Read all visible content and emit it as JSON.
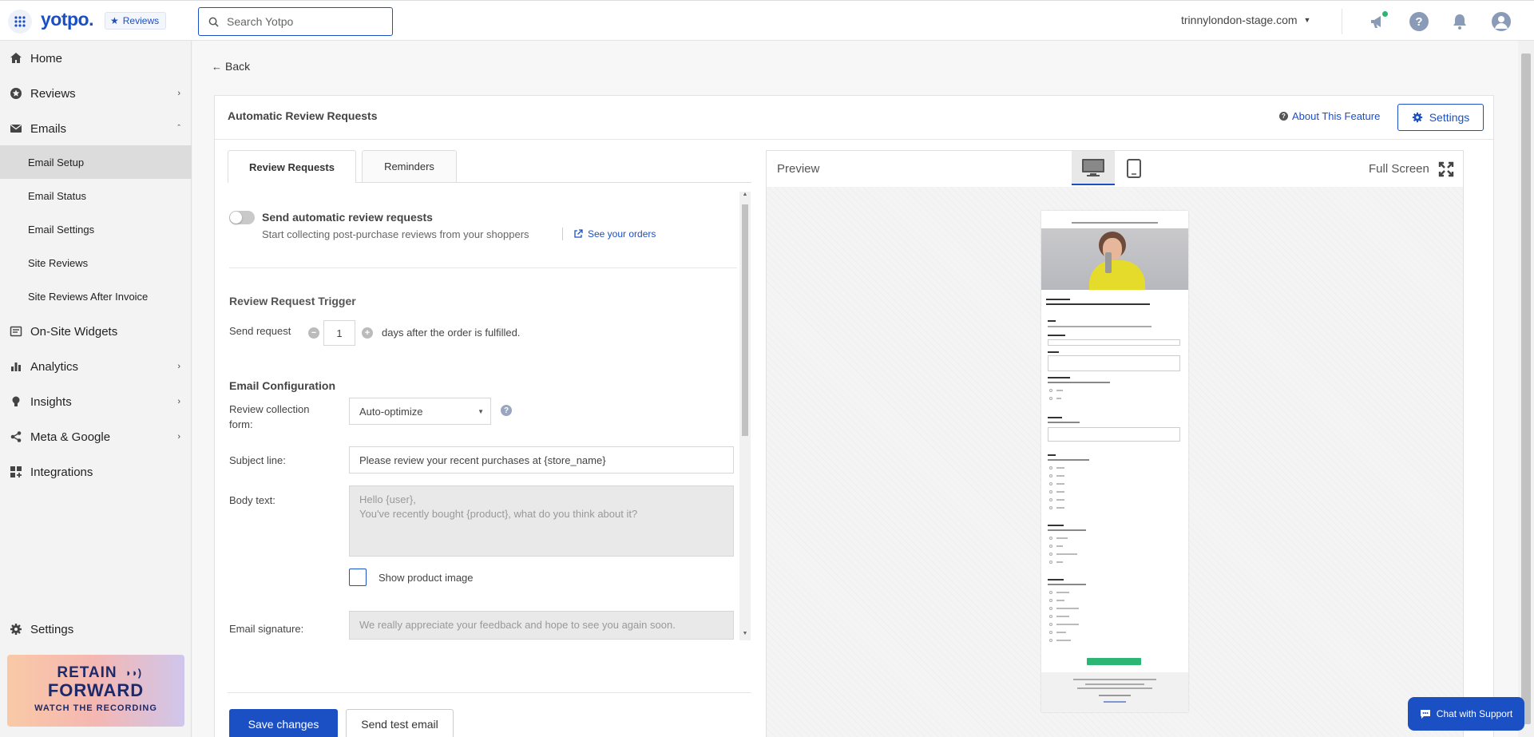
{
  "topbar": {
    "logo": "yotpo.",
    "product_badge": "Reviews",
    "search_placeholder": "Search Yotpo",
    "store": "trinnylondon-stage.com"
  },
  "sidebar": {
    "items": [
      {
        "label": "Home"
      },
      {
        "label": "Reviews"
      },
      {
        "label": "Emails"
      },
      {
        "label": "On-Site Widgets"
      },
      {
        "label": "Analytics"
      },
      {
        "label": "Insights"
      },
      {
        "label": "Meta & Google"
      },
      {
        "label": "Integrations"
      }
    ],
    "email_sub": [
      {
        "label": "Email Setup"
      },
      {
        "label": "Email Status"
      },
      {
        "label": "Email Settings"
      },
      {
        "label": "Site Reviews"
      },
      {
        "label": "Site Reviews After Invoice"
      }
    ],
    "settings": "Settings",
    "promo": {
      "line1": "RETAIN",
      "line2": "FORWARD",
      "line3": "WATCH THE RECORDING"
    }
  },
  "main": {
    "back": "Back",
    "card_title": "Automatic Review Requests",
    "about_link": "About This Feature",
    "settings_button": "Settings",
    "tabs": [
      {
        "label": "Review Requests"
      },
      {
        "label": "Reminders"
      }
    ],
    "toggle_label": "Send automatic review requests",
    "toggle_sub": "Start collecting post-purchase reviews from your shoppers",
    "see_orders": "See your orders",
    "trigger_heading": "Review Request Trigger",
    "send_request": "Send request",
    "days_value": "1",
    "days_after": "days after the order is fulfilled.",
    "config_heading": "Email Configuration",
    "form_label": "Review collection form:",
    "form_value": "Auto-optimize",
    "subject_label": "Subject line:",
    "subject_value": "Please review your recent purchases at {store_name}",
    "body_label": "Body text:",
    "body_line1": "Hello {user},",
    "body_line2": "You've recently bought {product}, what do you think about it?",
    "show_image": "Show product image",
    "signature_label": "Email signature:",
    "signature_value": "We really appreciate your feedback and hope to see you again soon.",
    "save_button": "Save changes",
    "test_button": "Send test email"
  },
  "preview": {
    "label": "Preview",
    "fullscreen": "Full Screen"
  },
  "chat": {
    "label": "Chat with Support"
  },
  "colors": {
    "brand": "#1b4fc4",
    "accent_green": "#2bb673"
  }
}
